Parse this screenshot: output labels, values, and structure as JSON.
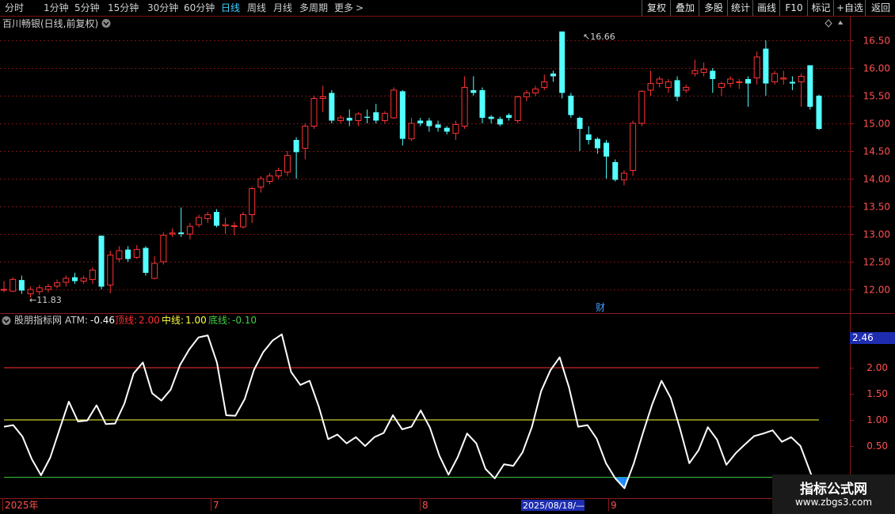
{
  "toolbar": {
    "periods": [
      "分时",
      "1分钟",
      "5分钟",
      "15分钟",
      "30分钟",
      "60分钟",
      "日线",
      "周线",
      "月线",
      "多周期",
      "更多"
    ],
    "active_period": "日线",
    "more_arrow": ">",
    "right_buttons": [
      "复权",
      "叠加",
      "多股",
      "统计",
      "画线",
      "F10",
      "标记",
      "+自选",
      "返回"
    ]
  },
  "main_panel": {
    "stock_title": "百川畅银(日线,前复权)",
    "high_label": "16.66",
    "low_label": "11.83",
    "event_marker": "财",
    "price_axis": [
      "16.50",
      "16.00",
      "15.50",
      "15.00",
      "14.50",
      "14.00",
      "13.50",
      "13.00",
      "12.50",
      "12.00"
    ]
  },
  "indicator_panel": {
    "name": "股朋指标网",
    "atm_label": "ATM:",
    "atm_value": "-0.46",
    "top_label": "顶线:",
    "top_value": "2.00",
    "mid_label": "中线:",
    "mid_value": "1.00",
    "bottom_label": "底线:",
    "bottom_value": "-0.10",
    "axis_labels": [
      "2.00",
      "1.50",
      "1.00",
      "0.50"
    ],
    "current_marker": "2.46"
  },
  "date_axis": {
    "labels": [
      "2025年",
      "7",
      "8",
      "2025/08/18/—",
      "9"
    ]
  },
  "watermark": {
    "title": "指标公式网",
    "url": "www.zbgs3.com"
  },
  "colors": {
    "up": "#ff3232",
    "down": "#54ffff",
    "atm_line": "#ffffff",
    "top_line": "#ff3030",
    "mid_line": "#ffff40",
    "bottom_line": "#40d040",
    "fill_low": "#1f8cff",
    "axis_text": "#ff5050",
    "active_tab": "#3fd0ff"
  },
  "chart_data": {
    "type": "candlestick",
    "price_range": [
      11.75,
      16.85
    ],
    "candles": [
      [
        12.0,
        12.0,
        12.15,
        11.95
      ],
      [
        11.97,
        12.18,
        12.22,
        11.95
      ],
      [
        12.17,
        11.98,
        12.25,
        11.92
      ],
      [
        11.92,
        12.0,
        12.05,
        11.85
      ],
      [
        11.96,
        12.03,
        12.08,
        11.9
      ],
      [
        12.0,
        12.05,
        12.1,
        11.95
      ],
      [
        12.06,
        12.12,
        12.18,
        12.02
      ],
      [
        12.13,
        12.2,
        12.25,
        12.05
      ],
      [
        12.22,
        12.15,
        12.3,
        12.1
      ],
      [
        12.15,
        12.2,
        12.25,
        12.1
      ],
      [
        12.18,
        12.35,
        12.4,
        12.1
      ],
      [
        12.97,
        12.05,
        12.98,
        12.0
      ],
      [
        12.08,
        12.62,
        12.7,
        11.93
      ],
      [
        12.55,
        12.7,
        12.78,
        12.5
      ],
      [
        12.72,
        12.55,
        12.78,
        12.5
      ],
      [
        12.58,
        12.72,
        12.8,
        12.55
      ],
      [
        12.75,
        12.3,
        12.78,
        12.25
      ],
      [
        12.2,
        12.47,
        12.6,
        12.18
      ],
      [
        12.5,
        12.98,
        13.03,
        12.45
      ],
      [
        13.0,
        13.02,
        13.1,
        12.95
      ],
      [
        13.03,
        13.0,
        13.48,
        12.95
      ],
      [
        13.0,
        13.14,
        13.2,
        12.9
      ],
      [
        13.17,
        13.3,
        13.35,
        13.12
      ],
      [
        13.28,
        13.35,
        13.4,
        13.2
      ],
      [
        13.4,
        13.15,
        13.45,
        13.12
      ],
      [
        13.15,
        13.17,
        13.3,
        13.0
      ],
      [
        13.15,
        13.15,
        13.22,
        12.98
      ],
      [
        13.13,
        13.35,
        13.4,
        13.1
      ],
      [
        13.35,
        13.82,
        13.85,
        13.2
      ],
      [
        13.85,
        14.0,
        14.05,
        13.75
      ],
      [
        13.95,
        14.05,
        14.1,
        13.9
      ],
      [
        14.05,
        14.15,
        14.2,
        14.0
      ],
      [
        14.12,
        14.42,
        14.5,
        14.05
      ],
      [
        14.7,
        14.48,
        14.75,
        14.0
      ],
      [
        14.55,
        14.95,
        15.0,
        14.35
      ],
      [
        14.95,
        15.45,
        15.5,
        14.9
      ],
      [
        15.45,
        15.48,
        15.68,
        15.2
      ],
      [
        15.55,
        15.05,
        15.6,
        15.0
      ],
      [
        15.05,
        15.1,
        15.15,
        15.0
      ],
      [
        15.1,
        15.05,
        15.25,
        14.95
      ],
      [
        15.05,
        15.17,
        15.2,
        14.95
      ],
      [
        15.12,
        15.1,
        15.25,
        15.0
      ],
      [
        15.2,
        15.05,
        15.35,
        15.0
      ],
      [
        15.05,
        15.18,
        15.22,
        15.0
      ],
      [
        15.1,
        15.6,
        15.65,
        15.08
      ],
      [
        15.58,
        14.72,
        15.6,
        14.6
      ],
      [
        14.72,
        15.0,
        15.1,
        14.68
      ],
      [
        15.05,
        15.0,
        15.1,
        14.95
      ],
      [
        15.05,
        14.95,
        15.1,
        14.85
      ],
      [
        14.98,
        14.92,
        15.05,
        14.85
      ],
      [
        14.92,
        14.85,
        14.95,
        14.8
      ],
      [
        14.82,
        14.98,
        15.05,
        14.7
      ],
      [
        14.95,
        15.65,
        15.85,
        14.9
      ],
      [
        15.6,
        15.55,
        15.85,
        15.5
      ],
      [
        15.6,
        15.1,
        15.65,
        15.0
      ],
      [
        15.12,
        15.08,
        15.15,
        15.0
      ],
      [
        15.08,
        14.98,
        15.12,
        14.95
      ],
      [
        15.15,
        15.1,
        15.18,
        15.05
      ],
      [
        15.05,
        15.48,
        15.5,
        15.0
      ],
      [
        15.48,
        15.55,
        15.6,
        15.4
      ],
      [
        15.55,
        15.62,
        15.68,
        15.5
      ],
      [
        15.65,
        15.75,
        15.88,
        15.6
      ],
      [
        15.9,
        15.85,
        15.95,
        15.75
      ],
      [
        16.66,
        15.55,
        16.66,
        15.45
      ],
      [
        15.5,
        15.15,
        15.55,
        15.1
      ],
      [
        15.1,
        14.9,
        15.12,
        14.5
      ],
      [
        14.8,
        14.7,
        14.95,
        14.62
      ],
      [
        14.72,
        14.55,
        14.75,
        14.45
      ],
      [
        14.65,
        14.4,
        14.7,
        14.0
      ],
      [
        14.3,
        13.98,
        14.35,
        13.95
      ],
      [
        13.98,
        14.1,
        14.15,
        13.88
      ],
      [
        14.15,
        15.0,
        15.05,
        14.05
      ],
      [
        15.0,
        15.58,
        15.6,
        14.95
      ],
      [
        15.6,
        15.72,
        15.95,
        15.5
      ],
      [
        15.72,
        15.8,
        15.85,
        15.65
      ],
      [
        15.65,
        15.75,
        15.8,
        15.55
      ],
      [
        15.78,
        15.48,
        15.85,
        15.4
      ],
      [
        15.6,
        15.65,
        15.7,
        15.55
      ],
      [
        15.9,
        15.95,
        16.15,
        15.85
      ],
      [
        15.92,
        15.98,
        16.1,
        15.85
      ],
      [
        15.95,
        15.8,
        16.0,
        15.55
      ],
      [
        15.65,
        15.72,
        15.75,
        15.5
      ],
      [
        15.72,
        15.8,
        15.85,
        15.65
      ],
      [
        15.75,
        15.75,
        15.8,
        15.62
      ],
      [
        15.8,
        15.72,
        15.85,
        15.3
      ],
      [
        15.82,
        16.2,
        16.3,
        15.7
      ],
      [
        16.35,
        15.72,
        16.5,
        15.5
      ],
      [
        15.75,
        15.9,
        15.95,
        15.7
      ],
      [
        15.8,
        15.82,
        15.95,
        15.7
      ],
      [
        15.75,
        15.72,
        15.85,
        15.6
      ],
      [
        15.75,
        15.85,
        15.9,
        15.3
      ],
      [
        16.05,
        15.3,
        16.05,
        15.25
      ],
      [
        15.5,
        14.9,
        15.52,
        14.88
      ]
    ],
    "atm": [
      0.87,
      0.9,
      0.68,
      0.25,
      -0.06,
      0.28,
      0.82,
      1.35,
      0.97,
      0.99,
      1.28,
      0.92,
      0.93,
      1.31,
      1.89,
      2.1,
      1.51,
      1.37,
      1.58,
      2.05,
      2.35,
      2.58,
      2.62,
      2.1,
      1.09,
      1.08,
      1.4,
      1.96,
      2.3,
      2.52,
      2.64,
      1.92,
      1.67,
      1.75,
      1.25,
      0.63,
      0.72,
      0.55,
      0.67,
      0.5,
      0.67,
      0.75,
      1.09,
      0.82,
      0.87,
      1.18,
      0.85,
      0.32,
      -0.05,
      0.29,
      0.74,
      0.55,
      0.06,
      -0.12,
      0.15,
      0.12,
      0.38,
      0.86,
      1.55,
      1.95,
      2.2,
      1.63,
      0.87,
      0.9,
      0.64,
      0.17,
      -0.12,
      -0.31,
      0.16,
      0.75,
      1.3,
      1.75,
      1.42,
      0.83,
      0.17,
      0.42,
      0.86,
      0.62,
      0.14,
      0.36,
      0.53,
      0.69,
      0.74,
      0.8,
      0.58,
      0.67,
      0.5,
      0.03,
      -0.46
    ]
  }
}
